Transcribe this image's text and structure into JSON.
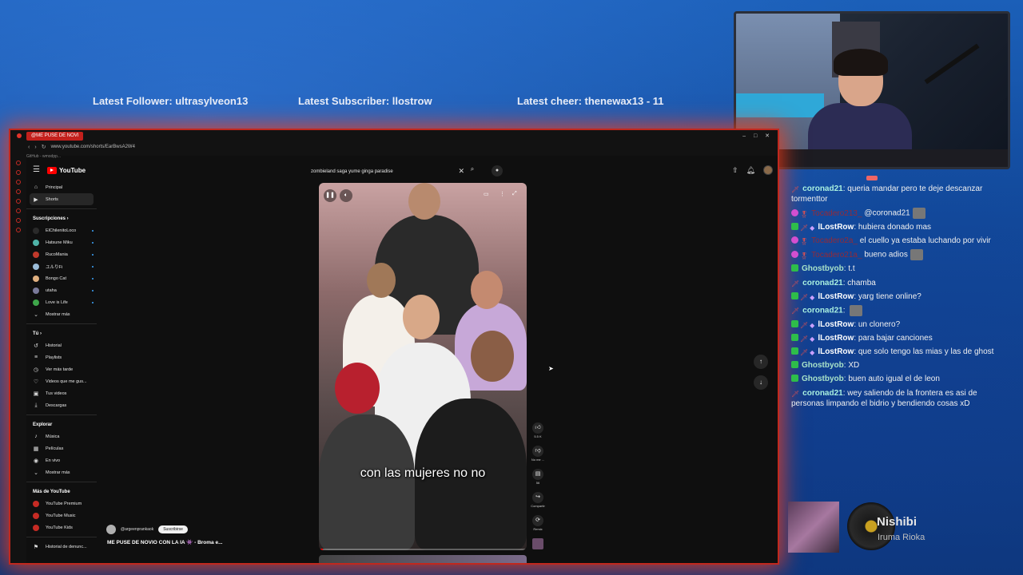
{
  "alerts": {
    "follower": "Latest Follower: ultrasylveon13",
    "subscriber": "Latest Subscriber: llostrow",
    "cheer": "Latest cheer: thenewax13 - 11"
  },
  "browser": {
    "tab_title": "@ME PUSE DE NOVI",
    "url": "www.youtube.com/shorts/EarBwsA2W4",
    "bookmark": "GitHub - wmodpp..."
  },
  "youtube": {
    "brand": "YouTube",
    "search_query": "zombieland saga yume ginga paradise",
    "nav_main": [
      {
        "label": "Principal",
        "icon": "home-icon"
      },
      {
        "label": "Shorts",
        "icon": "shorts-icon"
      }
    ],
    "subs_heading": "Suscripciones",
    "subscriptions": [
      {
        "label": "ElChilenitoLoco",
        "color": "#2a2a2a"
      },
      {
        "label": "Hatsune Miku",
        "color": "#4fb3a8"
      },
      {
        "label": "RucoMania",
        "color": "#c0392b"
      },
      {
        "label": "ユルりFi",
        "color": "#9bbcd8"
      },
      {
        "label": "Bongo Cat",
        "color": "#e0b080"
      },
      {
        "label": "utaha",
        "color": "#7a7a9a"
      },
      {
        "label": "Love is Life",
        "color": "#3ea64a"
      }
    ],
    "show_more": "Mostrar más",
    "you_heading": "Tú",
    "you_items": [
      {
        "label": "Historial",
        "icon": "history-icon"
      },
      {
        "label": "Playlists",
        "icon": "playlist-icon"
      },
      {
        "label": "Ver más tarde",
        "icon": "clock-icon"
      },
      {
        "label": "Videos que me gus...",
        "icon": "like-icon"
      },
      {
        "label": "Tus videos",
        "icon": "video-icon"
      },
      {
        "label": "Descargas",
        "icon": "download-icon"
      }
    ],
    "explore_heading": "Explorar",
    "explore_items": [
      {
        "label": "Música",
        "icon": "music-icon"
      },
      {
        "label": "Películas",
        "icon": "film-icon"
      },
      {
        "label": "En vivo",
        "icon": "live-icon"
      }
    ],
    "explore_more": "Mostrar más",
    "more_heading": "Más de YouTube",
    "more_items": [
      {
        "label": "YouTube Premium"
      },
      {
        "label": "YouTube Music"
      },
      {
        "label": "YouTube Kids"
      }
    ],
    "report_history": "Historial de denunc...",
    "short": {
      "caption": "con las mujeres no no",
      "channel": "@argeenprankaok",
      "subscribe": "Suscribirse",
      "title": "ME PUSE DE NOVIO CON LA IA 👾 - Broma e...",
      "likes": "5.5 K",
      "dislike_label": "No me ...",
      "comments": "56",
      "share_label": "Compartir",
      "remix_label": "Remix",
      "progress": 0.02
    }
  },
  "chat": [
    {
      "user": "coronad21",
      "user_class": "u-teal",
      "badges": [
        "sword"
      ],
      "text": "queria mandar pero te deje descanzar tormenttor"
    },
    {
      "user": "Tocadero213_",
      "user_class": "u-red",
      "badges": [
        "gem",
        "sub"
      ],
      "text": "@coronad21",
      "emote": true
    },
    {
      "user": "lLostRow",
      "user_class": "u-white",
      "badges": [
        "check",
        "sword",
        "bits"
      ],
      "text": "hubiera donado mas"
    },
    {
      "user": "Tocadero2a_",
      "user_class": "u-red",
      "badges": [
        "gem",
        "sub"
      ],
      "text": "el cuello ya estaba luchando por vivir"
    },
    {
      "user": "Tocadero21a_",
      "user_class": "u-red",
      "badges": [
        "gem",
        "sub"
      ],
      "text": "bueno adios",
      "emote": true
    },
    {
      "user": "Ghostbyob",
      "user_class": "u-grey",
      "badges": [
        "check"
      ],
      "text": "t.t"
    },
    {
      "user": "coronad21",
      "user_class": "u-teal",
      "badges": [
        "sword"
      ],
      "text": "chamba"
    },
    {
      "user": "lLostRow",
      "user_class": "u-white",
      "badges": [
        "check",
        "sword",
        "bits"
      ],
      "text": "yarg tiene online?"
    },
    {
      "user": "coronad21",
      "user_class": "u-teal",
      "badges": [
        "sword"
      ],
      "text": "",
      "emote": true
    },
    {
      "user": "lLostRow",
      "user_class": "u-white",
      "badges": [
        "check",
        "sword",
        "bits"
      ],
      "text": "un clonero?"
    },
    {
      "user": "lLostRow",
      "user_class": "u-white",
      "badges": [
        "check",
        "sword",
        "bits"
      ],
      "text": "para bajar canciones"
    },
    {
      "user": "lLostRow",
      "user_class": "u-white",
      "badges": [
        "check",
        "sword",
        "bits"
      ],
      "text": "que solo tengo las mias y las de ghost"
    },
    {
      "user": "Ghostbyob",
      "user_class": "u-grey",
      "badges": [
        "check"
      ],
      "text": "XD"
    },
    {
      "user": "Ghostbyob",
      "user_class": "u-grey",
      "badges": [
        "check"
      ],
      "text": "buen auto igual el de leon"
    },
    {
      "user": "coronad21",
      "user_class": "u-teal",
      "badges": [
        "sword"
      ],
      "text": "wey saliendo de la frontera es asi de personas limpando el bidrio y bendiendo cosas xD"
    }
  ],
  "now_playing": {
    "title": "Nishibi",
    "artist": "Iruma Rioka"
  }
}
